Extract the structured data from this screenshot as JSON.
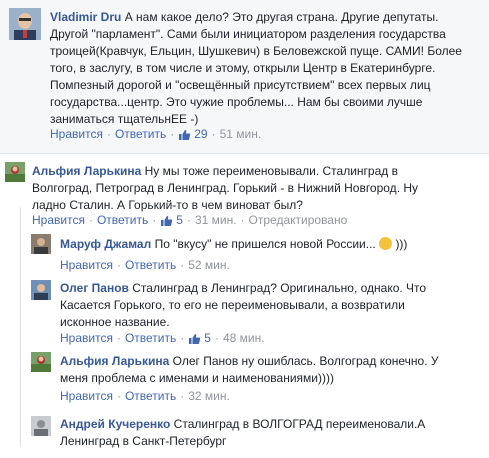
{
  "comments": [
    {
      "author": "Vladimir Dru",
      "text": "А нам какое дело? Это другая страна. Другие депутаты. Другой \"парламент\". Сами были инициатором разделения государства троицей(Кравчук, Ельцин, Шушкевич) в Беловежской пуще. САМИ! Более того, в заслугу, в том числе и этому, открыли Центр в Екатеринбурге. Помпезный дорогой и \"освещённый присутствием\" всех первых лиц государства...центр. Это чужие проблемы... Нам бы своими лучше заниматься тщательнЕЕ -)",
      "like_label": "Нравится",
      "reply_label": "Ответить",
      "likes": "29",
      "time": "51 мин."
    },
    {
      "author": "Альфия Ларькина",
      "text": "Ну мы тоже переименовывали. Сталинград в Волгоград, Петроград в Ленинград. Горький - в Нижний Новгород. Ну ладно Сталин. А Горький-то в чем виноват был?",
      "like_label": "Нравится",
      "reply_label": "Ответить",
      "likes": "5",
      "time": "31 мин.",
      "edited": "Отредактировано"
    },
    {
      "author": "Маруф Джамал",
      "text": "По \"вкусу\" не пришелся новой России...",
      "text_tail": ")))",
      "like_label": "Нравится",
      "reply_label": "Ответить",
      "time": "52 мин."
    },
    {
      "author": "Олег Панов",
      "text": "Сталинград в Ленинград? Оригинально, однако. Что Касается Горького, то его не переименовывали, а возвратили исконное название.",
      "like_label": "Нравится",
      "reply_label": "Ответить",
      "likes": "5",
      "time": "48 мин."
    },
    {
      "author": "Альфия Ларькина",
      "text": "Олег Панов ну ошиблась. Волгоград конечно. У меня проблема с именами и наименованиями))))",
      "like_label": "Нравится",
      "reply_label": "Ответить",
      "time": "32 мин."
    },
    {
      "author": "Андрей Кучеренко",
      "text": "Сталинград в ВОЛГОГРАД переименовали.А Ленинград в Санкт-Петербург"
    }
  ],
  "dot": "·",
  "colors": {
    "link": "#365899",
    "meta": "#90949c",
    "action": "#4267b2"
  }
}
